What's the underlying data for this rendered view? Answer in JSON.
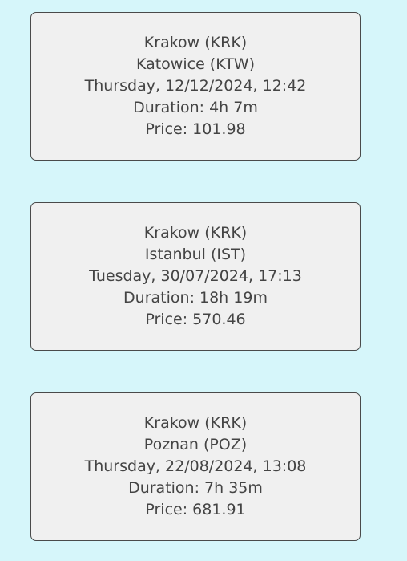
{
  "flights": [
    {
      "from": "Krakow (KRK)",
      "to": "Katowice (KTW)",
      "datetime": "Thursday, 12/12/2024, 12:42",
      "duration": "Duration: 4h 7m",
      "price": "Price: 101.98"
    },
    {
      "from": "Krakow (KRK)",
      "to": "Istanbul (IST)",
      "datetime": "Tuesday, 30/07/2024, 17:13",
      "duration": "Duration: 18h 19m",
      "price": "Price: 570.46"
    },
    {
      "from": "Krakow (KRK)",
      "to": "Poznan (POZ)",
      "datetime": "Thursday, 22/08/2024, 13:08",
      "duration": "Duration: 7h 35m",
      "price": "Price: 681.91"
    }
  ],
  "colors": {
    "background": "#d6f6fa",
    "card_background": "#f0f0f0",
    "card_border": "#4a4a4a",
    "text": "#444444"
  }
}
